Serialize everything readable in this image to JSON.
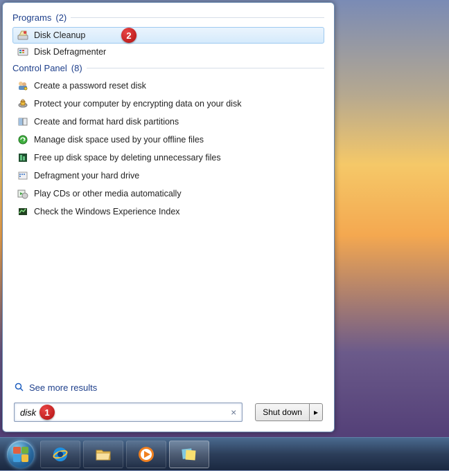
{
  "programs": {
    "header": "Programs",
    "count": "(2)",
    "items": [
      {
        "label": "Disk Cleanup",
        "icon": "disk-cleanup-icon",
        "selected": true
      },
      {
        "label": "Disk Defragmenter",
        "icon": "disk-defrag-icon",
        "selected": false
      }
    ]
  },
  "control_panel": {
    "header": "Control Panel",
    "count": "(8)",
    "items": [
      {
        "label": "Create a password reset disk",
        "icon": "users-key-icon"
      },
      {
        "label": "Protect your computer by encrypting data on your disk",
        "icon": "lock-disk-icon"
      },
      {
        "label": "Create and format hard disk partitions",
        "icon": "partition-icon"
      },
      {
        "label": "Manage disk space used by your offline files",
        "icon": "sync-green-icon"
      },
      {
        "label": "Free up disk space by deleting unnecessary files",
        "icon": "disk-usage-icon"
      },
      {
        "label": "Defragment your hard drive",
        "icon": "defrag-icon"
      },
      {
        "label": "Play CDs or other media automatically",
        "icon": "autoplay-icon"
      },
      {
        "label": "Check the Windows Experience Index",
        "icon": "wei-icon"
      }
    ]
  },
  "see_more": "See more results",
  "search": {
    "value": "disk",
    "clear": "×"
  },
  "shutdown": {
    "label": "Shut down",
    "arrow": "▸"
  },
  "annotations": {
    "step1": "1",
    "step2": "2"
  },
  "taskbar": {
    "apps": [
      {
        "name": "internet-explorer",
        "active": false
      },
      {
        "name": "file-explorer",
        "active": false
      },
      {
        "name": "media-player",
        "active": false
      },
      {
        "name": "sticky-notes",
        "active": true
      }
    ]
  }
}
